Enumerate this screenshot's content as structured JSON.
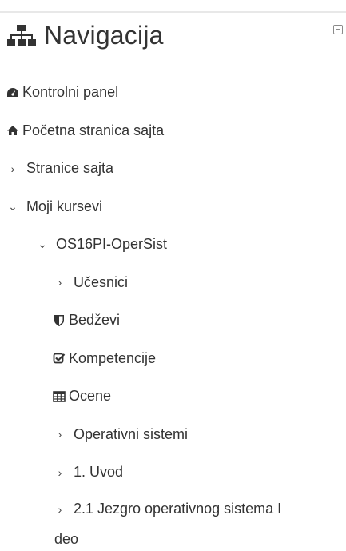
{
  "block": {
    "title": "Navigacija",
    "collapse_icon": "minus-square-icon",
    "title_icon": "sitemap-icon"
  },
  "nav": {
    "items": [
      {
        "label": "Kontrolni panel",
        "icon": "dashboard-icon"
      },
      {
        "label": "Početna stranica sajta",
        "icon": "home-icon"
      },
      {
        "label": "Stranice sajta",
        "icon": "chevron-right-icon"
      },
      {
        "label": "Moji kursevi",
        "icon": "chevron-down-icon"
      },
      {
        "label": "OS16PI-OperSist",
        "icon": "chevron-down-icon"
      },
      {
        "label": "Učesnici",
        "icon": "chevron-right-icon"
      },
      {
        "label": "Bedževi",
        "icon": "shield-icon"
      },
      {
        "label": "Kompetencije",
        "icon": "check-square-icon"
      },
      {
        "label": "Ocene",
        "icon": "table-icon"
      },
      {
        "label": "Operativni sistemi",
        "icon": "chevron-right-icon"
      },
      {
        "label": "1. Uvod",
        "icon": "chevron-right-icon"
      },
      {
        "label": "2.1 Jezgro operativnog sistema I",
        "label_cont": "deo",
        "icon": "chevron-right-icon"
      }
    ]
  },
  "colors": {
    "text": "#333333",
    "rule": "#dddddd"
  }
}
